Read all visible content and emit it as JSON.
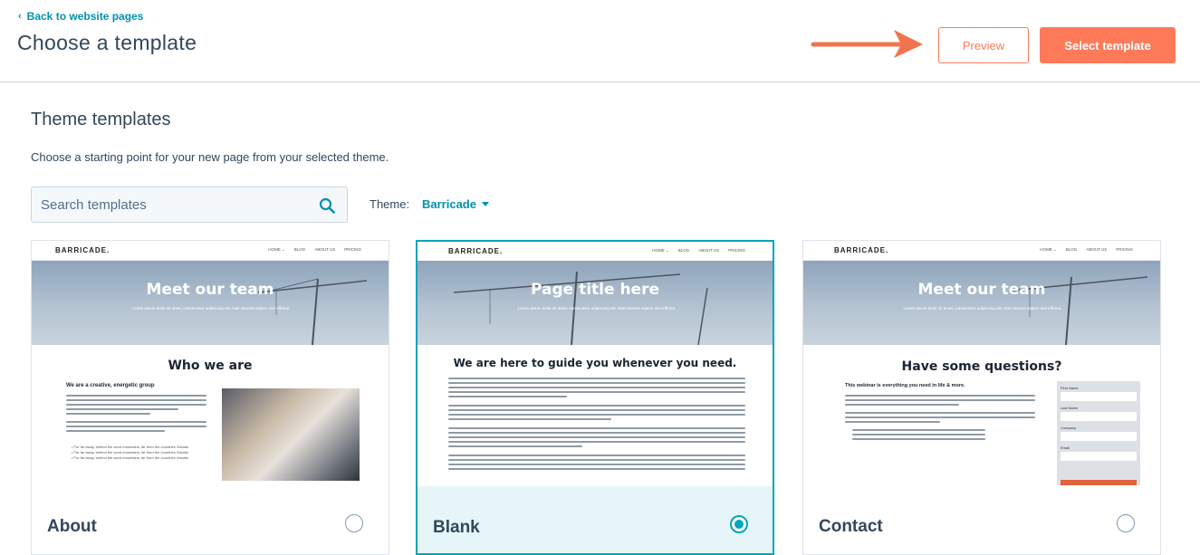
{
  "header": {
    "back_label": "Back to website pages",
    "title": "Choose a template",
    "preview_label": "Preview",
    "select_label": "Select template"
  },
  "section": {
    "title": "Theme templates",
    "description": "Choose a starting point for your new page from your selected theme."
  },
  "search": {
    "placeholder": "Search templates",
    "value": ""
  },
  "theme": {
    "label": "Theme:",
    "value": "Barricade"
  },
  "colors": {
    "accent": "#ff7a59",
    "link": "#0091ae",
    "selected": "#00a4bd",
    "text": "#33475b"
  },
  "thumb_common": {
    "logo": "BARRICADE.",
    "nav": [
      "HOME ⌄",
      "BLOG",
      "ABOUT US",
      "PRICING"
    ],
    "hero_sub": "Lorem ipsum dolor sit amet, consectetur adipiscing elit. Nam laoreet sapien sed efficitur."
  },
  "cards": [
    {
      "name": "About",
      "selected": false,
      "hero_title": "Meet our team",
      "heading": "Who we are",
      "subheading": "We are a creative, energetic group",
      "bullets": [
        "For far away, behind the word mountains, far from the countries Vokalia",
        "For far away, behind the word mountains, far from the countries Vokalia",
        "For far away, behind the word mountains, far from the countries Vokalia"
      ]
    },
    {
      "name": "Blank",
      "selected": true,
      "hero_title": "Page title here",
      "heading": "We are here to guide you whenever you need."
    },
    {
      "name": "Contact",
      "selected": false,
      "hero_title": "Meet our team",
      "heading": "Have some questions?",
      "subheading": "This webinar is everything you need in life & more.",
      "form_fields": [
        "First Name",
        "Last Name",
        "Company",
        "Email"
      ]
    }
  ]
}
